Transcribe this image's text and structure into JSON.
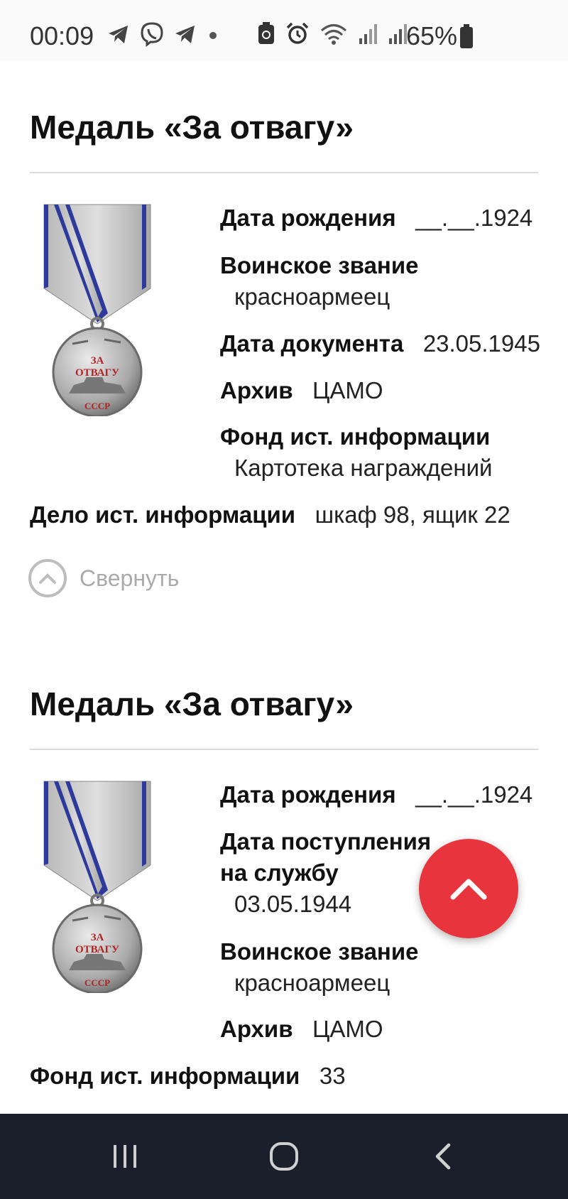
{
  "status_bar": {
    "time": "00:09",
    "battery": "65%",
    "icons_left": [
      "telegram-icon",
      "viber-icon",
      "telegram-icon",
      "dot-icon"
    ],
    "icons_right": [
      "battery-saver-icon",
      "alarm-icon",
      "wifi-icon",
      "signal-icon",
      "signal-icon"
    ]
  },
  "cards": [
    {
      "title": "Медаль «За отвагу»",
      "fields": [
        {
          "label": "Дата рождения",
          "value": "__.__.1924"
        },
        {
          "label": "Воинское звание",
          "value": "красноармеец"
        },
        {
          "label": "Дата документа",
          "value": "23.05.1945"
        },
        {
          "label": "Архив",
          "value": "ЦАМО"
        },
        {
          "label": "Фонд ист. информации",
          "value": "Картотека награждений"
        },
        {
          "label": "Дело ист. информации",
          "value": "шкаф 98, ящик 22"
        }
      ],
      "collapse_label": "Свернуть"
    },
    {
      "title": "Медаль «За отвагу»",
      "fields": [
        {
          "label": "Дата рождения",
          "value": "__.__.1924"
        },
        {
          "label": "Дата поступления на службу",
          "value": "03.05.1944"
        },
        {
          "label": "Воинское звание",
          "value": "красноармеец"
        },
        {
          "label": "Архив",
          "value": "ЦАМО"
        },
        {
          "label": "Фонд ист. информации",
          "value": "33"
        }
      ]
    }
  ],
  "medal": {
    "inscription_line1": "ЗА",
    "inscription_line2": "ОТВАГУ",
    "inscription_line3": "СССР"
  },
  "colors": {
    "accent": "#e8343c",
    "nav_bg": "#1a1f2b"
  }
}
